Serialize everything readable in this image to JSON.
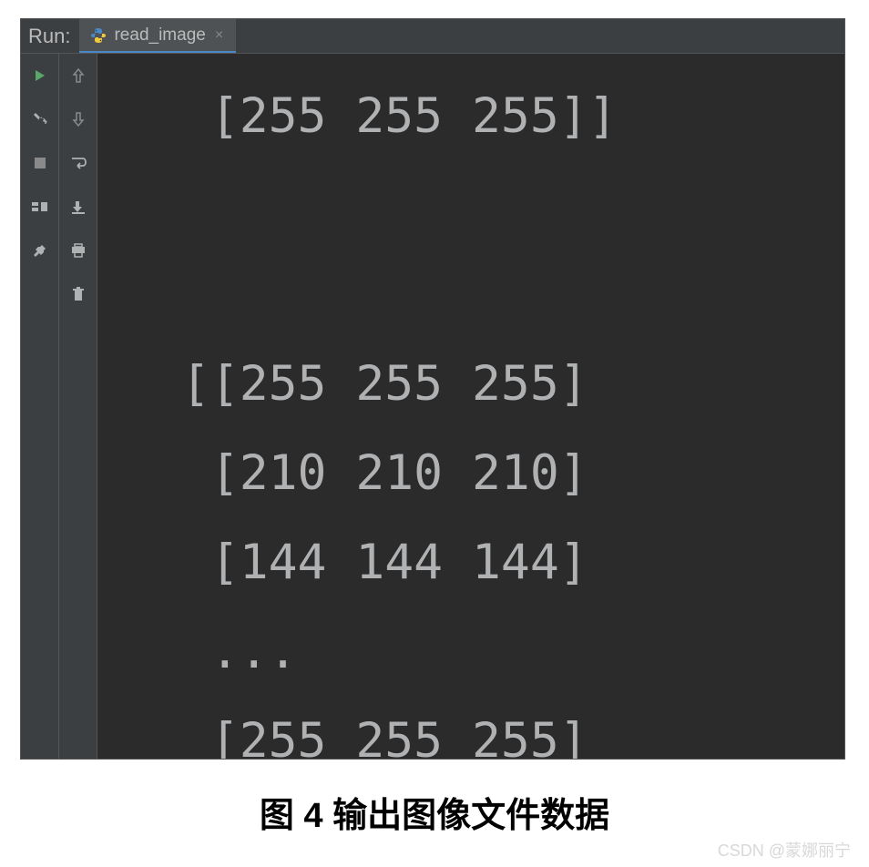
{
  "tabBar": {
    "runLabel": "Run:",
    "tabName": "read_image"
  },
  "console": {
    "lines": [
      "  [255 255 255]]",
      "",
      "",
      " [[255 255 255]",
      "  [210 210 210]",
      "  [144 144 144]",
      "  ...",
      "  [255 255 255]"
    ]
  },
  "caption": "图 4 输出图像文件数据",
  "watermark": "CSDN @蒙娜丽宁",
  "icons": {
    "play": "play-icon",
    "wrench": "wrench-icon",
    "stop": "stop-icon",
    "layout": "layout-icon",
    "pin": "pin-icon",
    "arrowUp": "arrow-up-icon",
    "arrowDown": "arrow-down-icon",
    "wrap": "wrap-icon",
    "scrollEnd": "scroll-end-icon",
    "print": "print-icon",
    "trash": "trash-icon"
  }
}
